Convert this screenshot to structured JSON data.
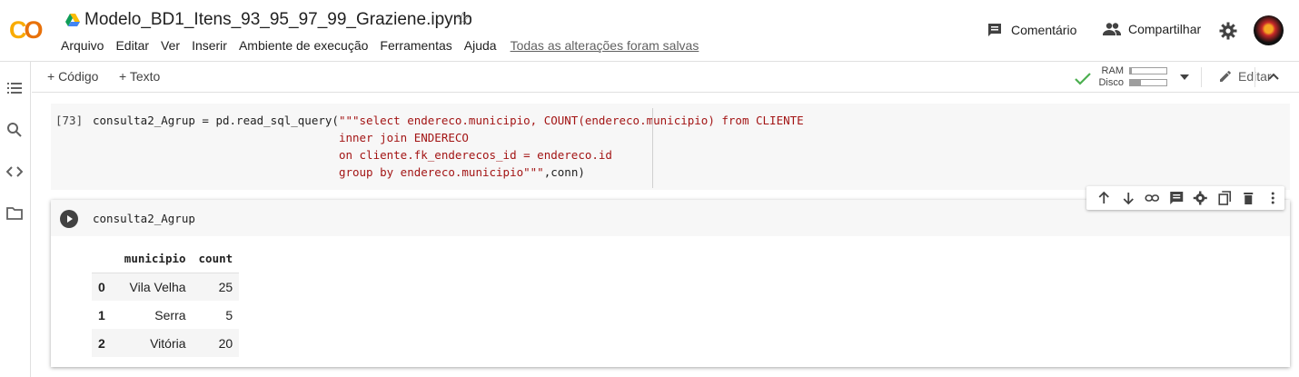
{
  "app": {
    "logo": "CO",
    "title": "Modelo_BD1_Itens_93_95_97_99_Graziene.ipynb"
  },
  "menu": {
    "items": [
      "Arquivo",
      "Editar",
      "Ver",
      "Inserir",
      "Ambiente de execução",
      "Ferramentas",
      "Ajuda"
    ],
    "saved_status": "Todas as alterações foram salvas"
  },
  "header": {
    "comment_label": "Comentário",
    "share_label": "Compartilhar"
  },
  "toolbar": {
    "add_code": "+ Código",
    "add_text": "+ Texto",
    "ram_label": "RAM",
    "disk_label": "Disco",
    "ram_usage": 0.04,
    "disk_usage": 0.3,
    "edit_label": "Editar"
  },
  "code_cell": {
    "prompt": "[73]",
    "lines": [
      {
        "pre": "consulta2_Agrup = pd.read_sql_query(",
        "str": "\"\"\"select endereco.municipio, COUNT(endereco.municipio) from CLIENTE",
        "post": ""
      },
      {
        "pre": "                                    ",
        "str": "inner join ENDERECO",
        "post": ""
      },
      {
        "pre": "                                    ",
        "str": "on cliente.fk_enderecos_id = endereco.id",
        "post": ""
      },
      {
        "pre": "                                    ",
        "str": "group by endereco.municipio\"\"\"",
        "post": ",conn)"
      }
    ]
  },
  "run_cell": {
    "code": "consulta2_Agrup"
  },
  "dataframe": {
    "columns": [
      "municipio",
      "count"
    ],
    "rows": [
      {
        "index": "0",
        "municipio": "Vila Velha",
        "count": "25"
      },
      {
        "index": "1",
        "municipio": "Serra",
        "count": "5"
      },
      {
        "index": "2",
        "municipio": "Vitória",
        "count": "20"
      }
    ]
  }
}
